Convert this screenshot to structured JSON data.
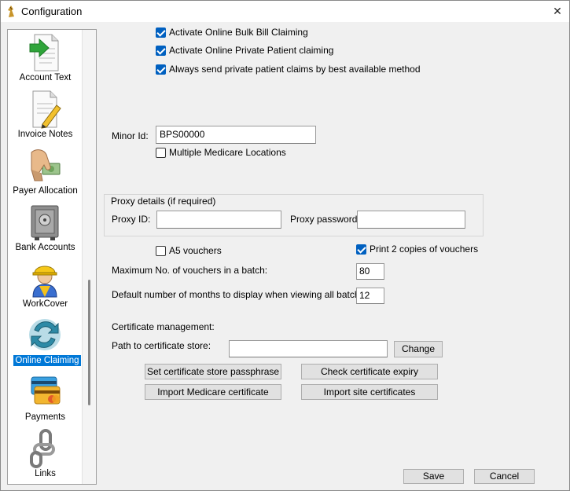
{
  "window": {
    "title": "Configuration"
  },
  "sidebar": {
    "items": [
      {
        "label": "Account Text",
        "icon": "document-arrow-icon"
      },
      {
        "label": "Invoice Notes",
        "icon": "notes-pencil-icon"
      },
      {
        "label": "Payer Allocation",
        "icon": "hand-money-icon"
      },
      {
        "label": "Bank Accounts",
        "icon": "safe-icon"
      },
      {
        "label": "WorkCover",
        "icon": "worker-hardhat-icon"
      },
      {
        "label": "Online Claiming",
        "icon": "recycle-arrows-icon",
        "selected": true
      },
      {
        "label": "Payments",
        "icon": "credit-cards-icon"
      },
      {
        "label": "Links",
        "icon": "chain-links-icon"
      }
    ]
  },
  "options": {
    "bulk_bill": {
      "label": "Activate Online Bulk Bill Claiming",
      "checked": true
    },
    "private_patient": {
      "label": "Activate Online Private Patient claiming",
      "checked": true
    },
    "best_method": {
      "label": "Always send private patient claims by best available method",
      "checked": true
    }
  },
  "minor": {
    "label": "Minor Id:",
    "value": "BPS00000",
    "multiple_locations": {
      "label": "Multiple Medicare Locations",
      "checked": false
    }
  },
  "proxy": {
    "legend": "Proxy details (if required)",
    "id_label": "Proxy ID:",
    "id_value": "",
    "password_label": "Proxy password:",
    "password_value": ""
  },
  "vouchers": {
    "a5": {
      "label": "A5 vouchers",
      "checked": false
    },
    "print_two": {
      "label": "Print 2 copies of vouchers",
      "checked": true
    },
    "max_label": "Maximum No. of vouchers in a batch:",
    "max_value": "80",
    "months_label": "Default number of months to display when viewing all batches:",
    "months_value": "12"
  },
  "certificate": {
    "heading": "Certificate management:",
    "path_label": "Path to certificate store:",
    "path_value": "",
    "change_label": "Change",
    "set_passphrase_label": "Set certificate store passphrase",
    "check_expiry_label": "Check certificate expiry",
    "import_medicare_label": "Import Medicare certificate",
    "import_site_label": "Import site certificates"
  },
  "footer": {
    "save_label": "Save",
    "cancel_label": "Cancel"
  },
  "colors": {
    "accent": "#0078d7",
    "checkbox": "#0060c0",
    "window_bg": "#f0f0f0"
  }
}
